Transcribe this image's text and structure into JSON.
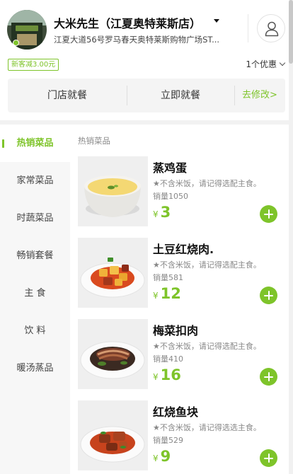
{
  "store": {
    "name": "大米先生（江夏奥特莱斯店）",
    "address": "江夏大道56号罗马春天奥特莱斯购物广场ST..."
  },
  "promo": {
    "badge": "新客减3.00元",
    "coupons": "1个优惠"
  },
  "dine": {
    "option_store": "门店就餐",
    "option_now": "立即就餐",
    "change": "去修改>"
  },
  "sidebar": {
    "items": [
      {
        "label": "热销菜品"
      },
      {
        "label": "家常菜品"
      },
      {
        "label": "时蔬菜品"
      },
      {
        "label": "畅销套餐"
      },
      {
        "label": "主 食"
      },
      {
        "label": "饮 料"
      },
      {
        "label": "暖汤蒸品"
      }
    ]
  },
  "section_title": "热销菜品",
  "currency": "¥",
  "items": [
    {
      "name": "蒸鸡蛋",
      "note": "★不含米饭，请记得选配主食。",
      "sales": "销量1050",
      "price": "3"
    },
    {
      "name": "土豆红烧肉.",
      "note": "★不含米饭，请记得选配主食。",
      "sales": "销量581",
      "price": "12"
    },
    {
      "name": "梅菜扣肉",
      "note": "★不含米饭，请记得选配主食。",
      "sales": "销量410",
      "price": "16"
    },
    {
      "name": "红烧鱼块",
      "note": "★不含米饭，请记得选选主食。",
      "sales": "销量529",
      "price": "9"
    }
  ],
  "colors": {
    "accent": "#7ec42a",
    "sidebar_bg": "#f7f7f7",
    "dine_bar_bg": "#f4f4f4"
  },
  "icons": {
    "user": "user-icon",
    "dropdown": "caret-down-icon",
    "add": "plus-icon",
    "coupon_chevron": "chevron-down-icon"
  }
}
